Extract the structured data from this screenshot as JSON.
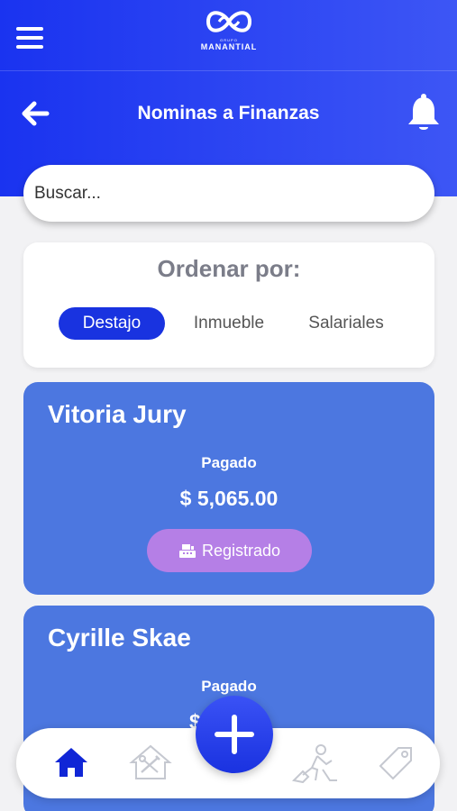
{
  "app": {
    "logo_small": "GRUPO",
    "logo_brand": "MANANTIAL"
  },
  "header": {
    "title": "Nominas a Finanzas"
  },
  "search": {
    "placeholder": "Buscar..."
  },
  "sort": {
    "title": "Ordenar por:",
    "options": [
      {
        "label": "Destajo",
        "active": true
      },
      {
        "label": "Inmueble",
        "active": false
      },
      {
        "label": "Salariales",
        "active": false
      }
    ]
  },
  "employees": [
    {
      "name": "Vitoria Jury",
      "status": "Pagado",
      "amount": "$ 5,065.00",
      "badge": "Registrado"
    },
    {
      "name": "Cyrille Skae",
      "status": "Pagado",
      "amount": "$ 2,        0"
    }
  ],
  "nav": {
    "items": [
      "home-icon",
      "house-tools-icon",
      "add-icon",
      "worker-icon",
      "tag-icon"
    ],
    "active": "home-icon"
  },
  "colors": {
    "header_gradient_start": "#1a33f0",
    "header_gradient_end": "#3d56f5",
    "card_blue": "#4c77e0",
    "badge_purple": "#b57fe6",
    "active_pill": "#1933e0"
  }
}
